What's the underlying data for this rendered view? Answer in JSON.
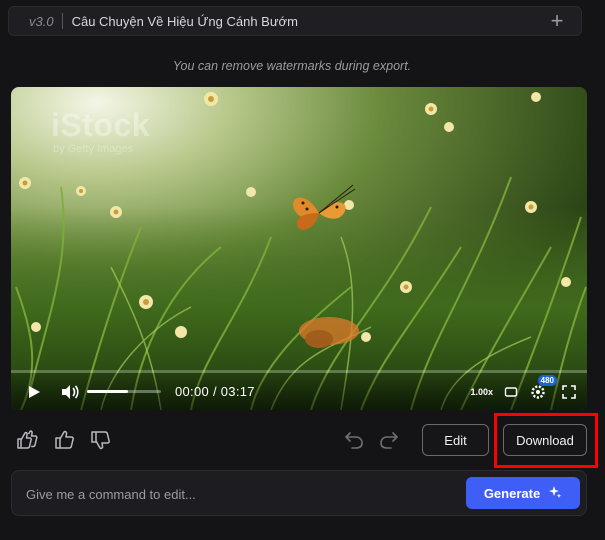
{
  "header": {
    "version": "v3.0",
    "title": "Câu Chuyện Về Hiệu Ứng Cánh Bướm",
    "add_icon": "plus-icon"
  },
  "hint": "You can remove watermarks during export.",
  "video": {
    "watermark": "iStock",
    "watermark_sub": "by Getty Images",
    "time_display": "00:00 / 03:17",
    "progress": 0,
    "volume": 0.55,
    "speed": "1.00x",
    "quality_badge": "480",
    "icons": [
      "play-icon",
      "volume-icon",
      "loop-icon",
      "settings-icon",
      "fullscreen-icon"
    ]
  },
  "actions": {
    "icons": [
      "double-thumbs-up-icon",
      "thumbs-up-icon",
      "thumbs-down-icon",
      "undo-icon",
      "redo-icon"
    ],
    "edit_label": "Edit",
    "download_label": "Download"
  },
  "command": {
    "placeholder": "Give me a command to edit...",
    "value": "",
    "generate_label": "Generate",
    "generate_icon": "sparkle-icon"
  },
  "colors": {
    "accent": "#3f5ef5",
    "highlight": "#ff0000",
    "progress": "#e8f26a",
    "badge": "#1e63d6"
  }
}
